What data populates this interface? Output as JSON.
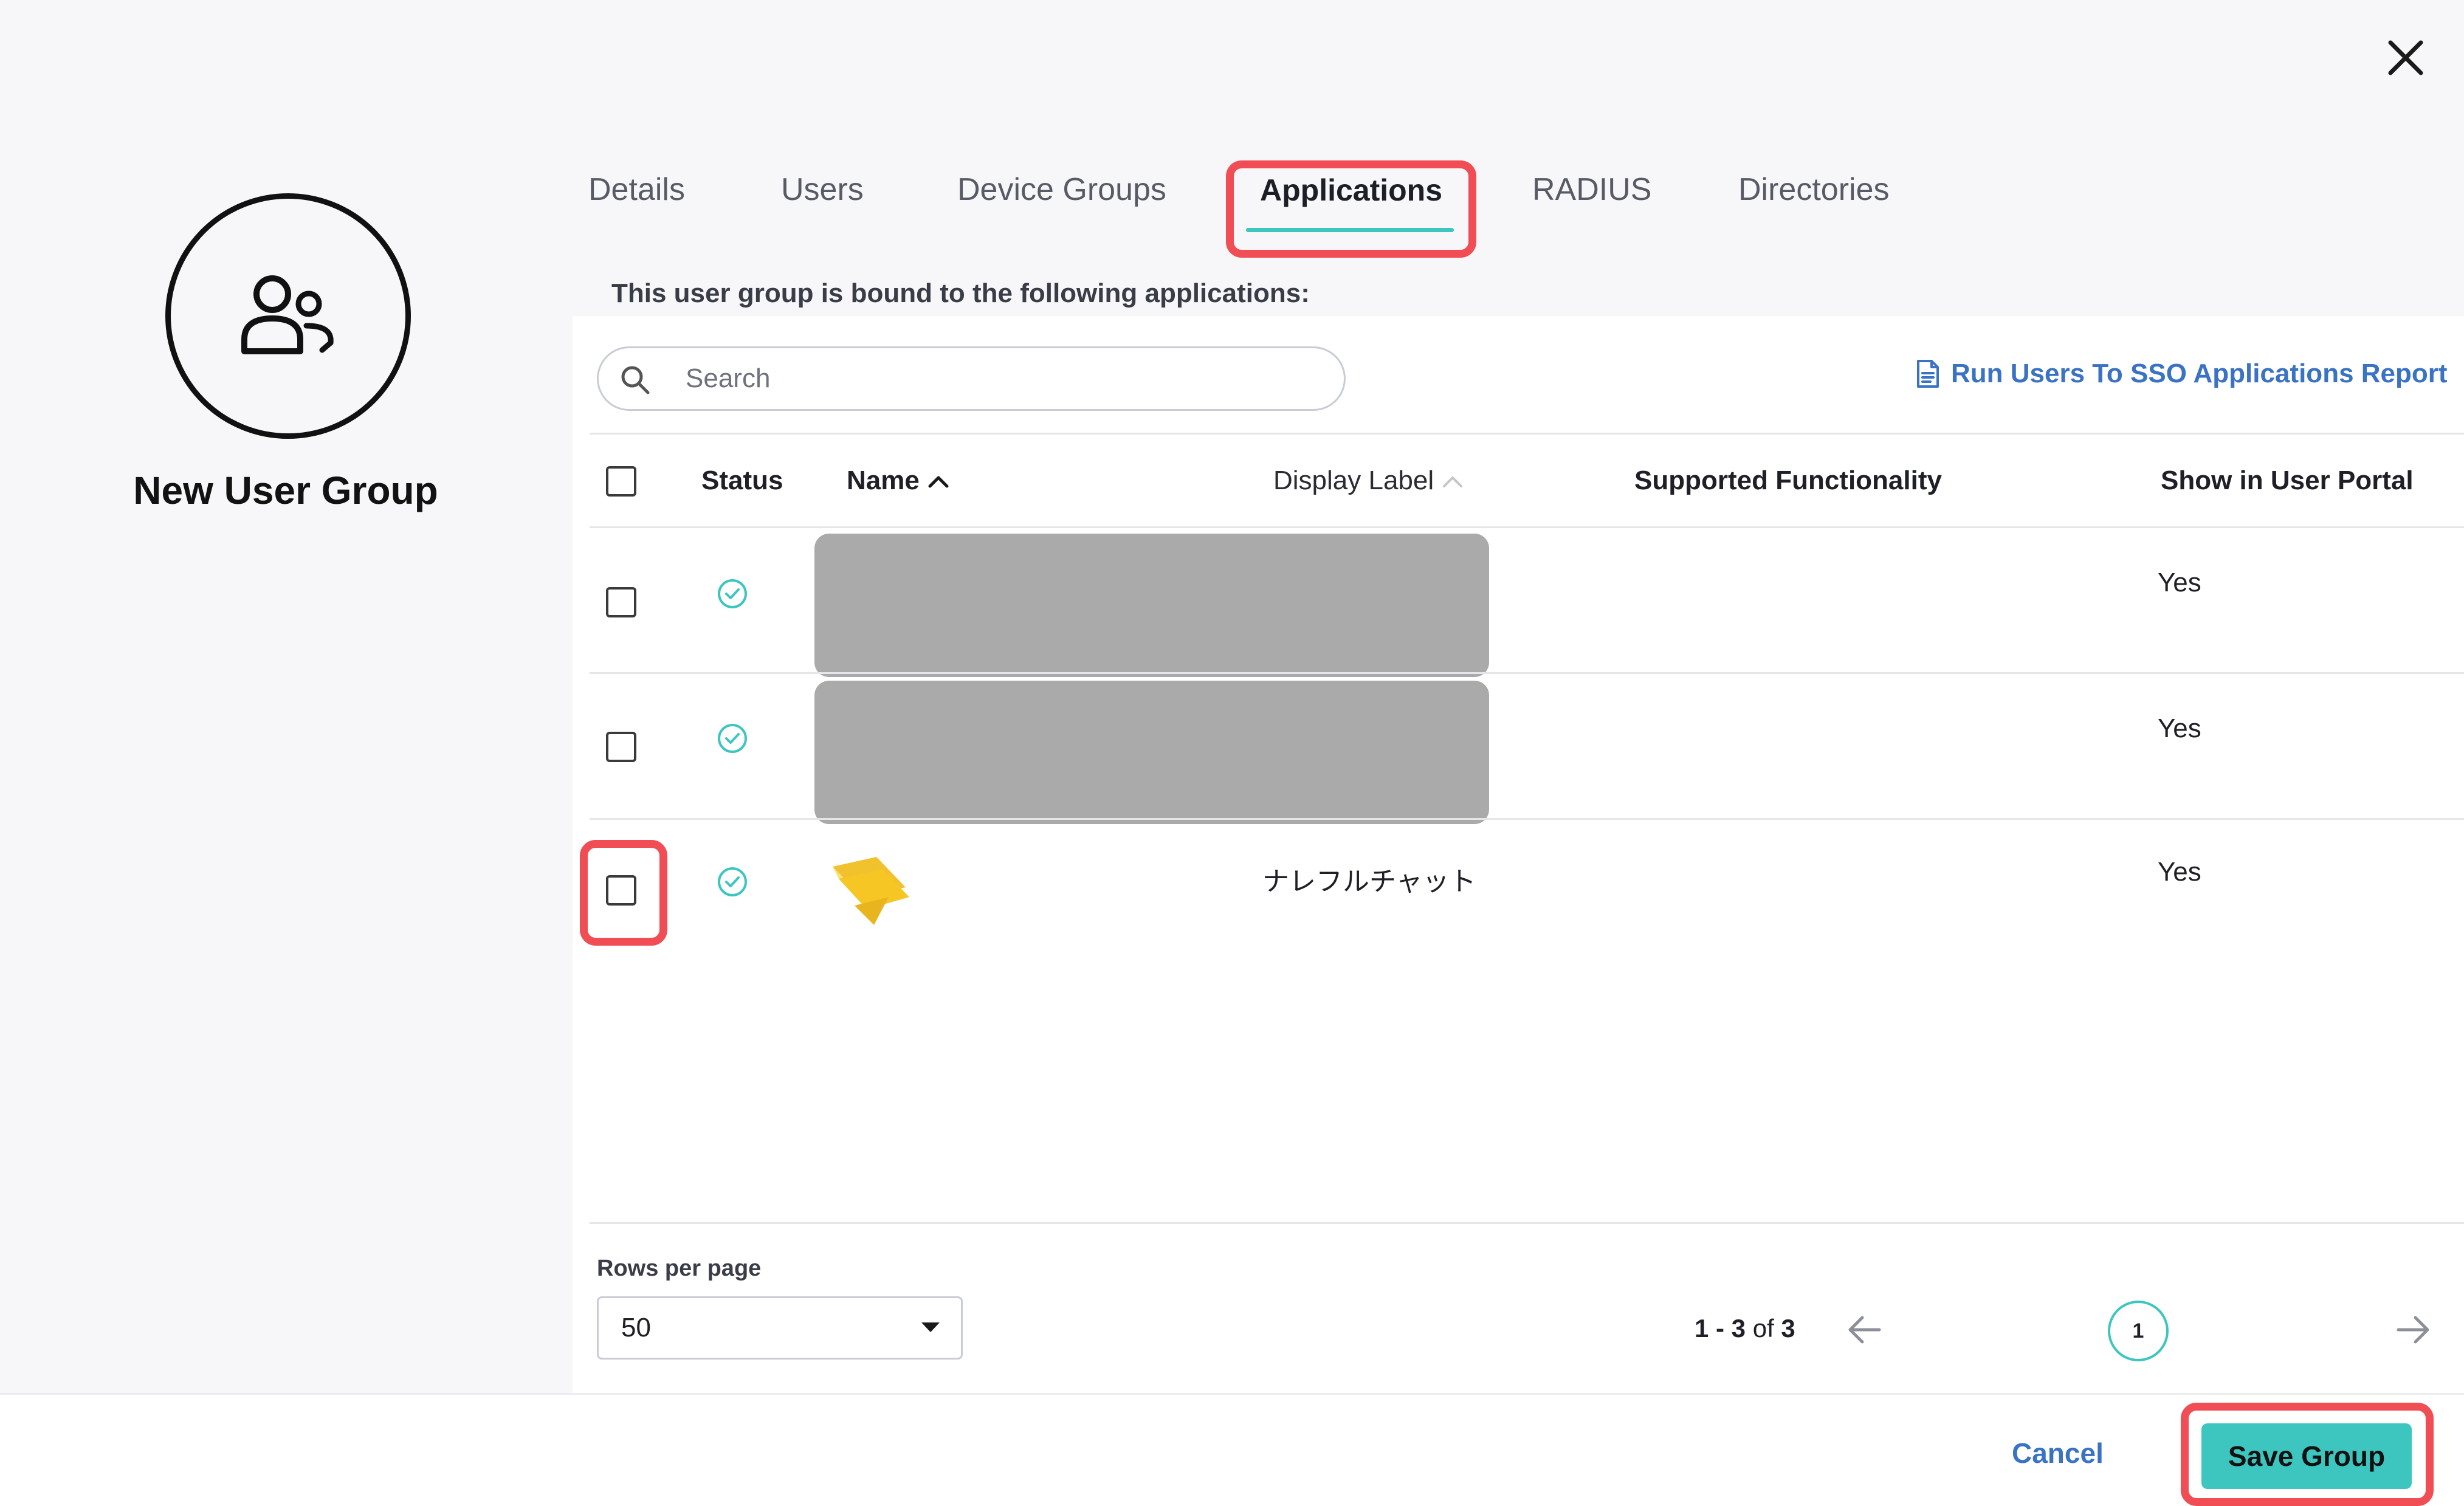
{
  "group": {
    "title": "New User Group"
  },
  "tabs": [
    {
      "label": "Details"
    },
    {
      "label": "Users"
    },
    {
      "label": "Device Groups"
    },
    {
      "label": "Applications"
    },
    {
      "label": "RADIUS"
    },
    {
      "label": "Directories"
    }
  ],
  "active_tab": "Applications",
  "content": {
    "bound_text": "This user group is bound to the following applications:"
  },
  "search": {
    "placeholder": "Search",
    "value": ""
  },
  "report_link": {
    "label": "Run Users To SSO Applications Report"
  },
  "table": {
    "columns": {
      "status": "Status",
      "name": "Name",
      "display_label": "Display Label",
      "supported_functionality": "Supported Functionality",
      "show_in_user_portal": "Show in User Portal"
    },
    "rows": [
      {
        "status": "active",
        "name": "",
        "display_label": "",
        "supported_functionality": "",
        "show_in_portal": "Yes",
        "redacted": true
      },
      {
        "status": "active",
        "name": "",
        "display_label": "",
        "supported_functionality": "",
        "show_in_portal": "Yes",
        "redacted": true
      },
      {
        "status": "active",
        "name": "",
        "display_label": "ナレフルチャット",
        "supported_functionality": "",
        "show_in_portal": "Yes",
        "redacted": false
      }
    ]
  },
  "pagination": {
    "rows_per_page_label": "Rows per page",
    "rows_per_page": "50",
    "range": "1 - 3",
    "of_word": "of",
    "total": "3",
    "current_page": "1"
  },
  "footer": {
    "cancel_label": "Cancel",
    "save_label": "Save Group"
  },
  "colors": {
    "accent": "#3cc6bf",
    "link": "#3a72c4",
    "highlight": "#f04d55",
    "redacted": "#aaaaaa",
    "app_logo": "#f2c12e"
  }
}
